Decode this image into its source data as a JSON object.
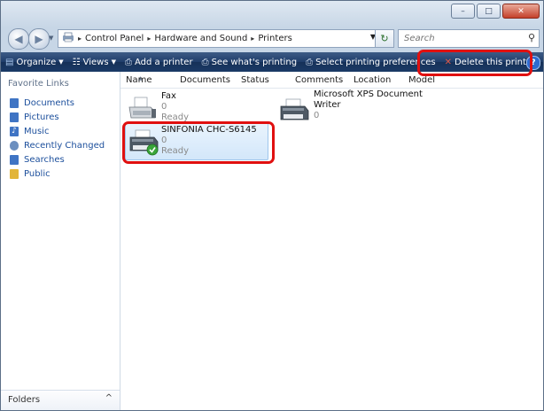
{
  "window": {
    "minimize_glyph": "–",
    "maximize_glyph": "□",
    "close_glyph": "✕"
  },
  "address": {
    "crumbs": [
      "Control Panel",
      "Hardware and Sound",
      "Printers"
    ],
    "separator": "▸"
  },
  "search": {
    "placeholder": "Search"
  },
  "toolbar": {
    "organize": "Organize",
    "views": "Views",
    "add_printer": "Add a printer",
    "see_printing": "See what's printing",
    "select_prefs": "Select printing preferences",
    "delete_printer": "Delete this printer",
    "more": "»",
    "help": "?"
  },
  "sidebar": {
    "title": "Favorite Links",
    "items": [
      {
        "label": "Documents",
        "icon": "documents-icon",
        "color": "#3f74c4"
      },
      {
        "label": "Pictures",
        "icon": "pictures-icon",
        "color": "#3f74c4"
      },
      {
        "label": "Music",
        "icon": "music-icon",
        "color": "#3f74c4"
      },
      {
        "label": "Recently Changed",
        "icon": "recently-changed-icon",
        "color": "#6c8fbf"
      },
      {
        "label": "Searches",
        "icon": "searches-icon",
        "color": "#3f74c4"
      },
      {
        "label": "Public",
        "icon": "public-folder-icon",
        "color": "#e2b53a"
      }
    ],
    "folders_label": "Folders",
    "folders_chevron": "^"
  },
  "columns": [
    "Name",
    "Documents",
    "Status",
    "Comments",
    "Location",
    "Model"
  ],
  "printers": [
    {
      "name": "Fax",
      "docs": "0",
      "status": "Ready"
    },
    {
      "name": "Microsoft XPS Document Writer",
      "line1": "Microsoft XPS Document",
      "line2": "Writer",
      "docs": "0"
    },
    {
      "name": "SINFONIA CHC-S6145",
      "docs": "0",
      "status": "Ready"
    }
  ],
  "colors": {
    "toolbar": "#1f3d6a",
    "link": "#1c4f9c",
    "highlight_box": "#e01010",
    "selection": "#d3e7fa"
  }
}
